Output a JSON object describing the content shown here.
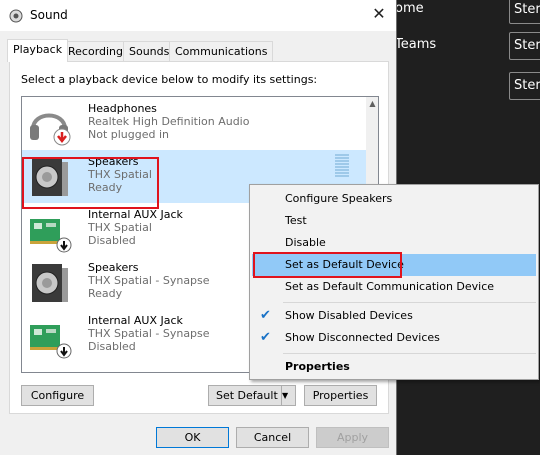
{
  "window": {
    "title": "Sound",
    "close_label": "✕"
  },
  "tabs": [
    {
      "label": "Playback"
    },
    {
      "label": "Recording"
    },
    {
      "label": "Sounds"
    },
    {
      "label": "Communications"
    }
  ],
  "instruction": "Select a playback device below to modify its settings:",
  "devices": [
    {
      "name": "Headphones",
      "description": "Realtek High Definition Audio",
      "status": "Not plugged in",
      "icon": "headphones-icon"
    },
    {
      "name": "Speakers",
      "description": "THX Spatial",
      "status": "Ready",
      "icon": "speaker-icon"
    },
    {
      "name": "Internal AUX Jack",
      "description": "THX Spatial",
      "status": "Disabled",
      "icon": "circuit-board-icon"
    },
    {
      "name": "Speakers",
      "description": "THX Spatial - Synapse",
      "status": "Ready",
      "icon": "speaker-icon"
    },
    {
      "name": "Internal AUX Jack",
      "description": "THX Spatial - Synapse",
      "status": "Disabled",
      "icon": "circuit-board-icon"
    }
  ],
  "buttons": {
    "configure": "Configure",
    "set_default": "Set Default",
    "properties": "Properties",
    "ok": "OK",
    "cancel": "Cancel",
    "apply": "Apply"
  },
  "context_menu": {
    "items": [
      {
        "label": "Configure Speakers"
      },
      {
        "label": "Test"
      },
      {
        "label": "Disable"
      },
      {
        "label": "Set as Default Device"
      },
      {
        "label": "Set as Default Communication Device"
      },
      {
        "label": "Show Disabled Devices",
        "checked": true
      },
      {
        "label": "Show Disconnected Devices",
        "checked": true
      },
      {
        "label": "Properties"
      }
    ]
  },
  "background_app": {
    "rows": [
      {
        "label": "ome",
        "button": "Ster"
      },
      {
        "label": "Teams",
        "button": "Ster"
      },
      {
        "label": "",
        "button": "Ster"
      }
    ]
  },
  "colors": {
    "selection": "#cce8ff",
    "menu_highlight": "#91c9f7",
    "annotation_red": "#e0131d",
    "accent": "#0078d7"
  }
}
